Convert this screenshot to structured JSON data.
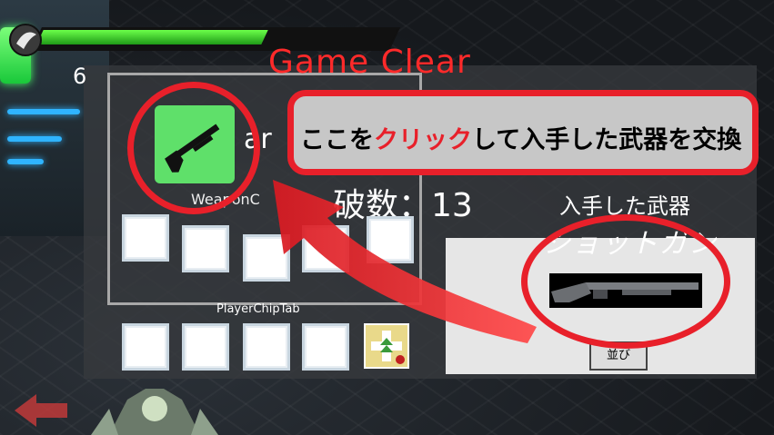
{
  "hud": {
    "counter": "6",
    "health_fraction": 0.65
  },
  "banner": {
    "title": "Game Clear"
  },
  "result": {
    "weapon_tab": "WeaponC",
    "weapon_tab_partial_label": "ar",
    "destroy_label": "破数：13",
    "player_chip_tab": "PlayerChipTab",
    "acquired_label": "入手した武器",
    "acquired_name": "ショットガン",
    "small_button": "並び"
  },
  "callout": {
    "before": "ここを",
    "highlight": "クリック",
    "after": "して入手した武器を交換"
  },
  "colors": {
    "annotation_red": "#e8202a",
    "title_red": "#ff2a2a",
    "weapon_slot_green": "#5fe06a",
    "health_green": "#3cd02a"
  }
}
